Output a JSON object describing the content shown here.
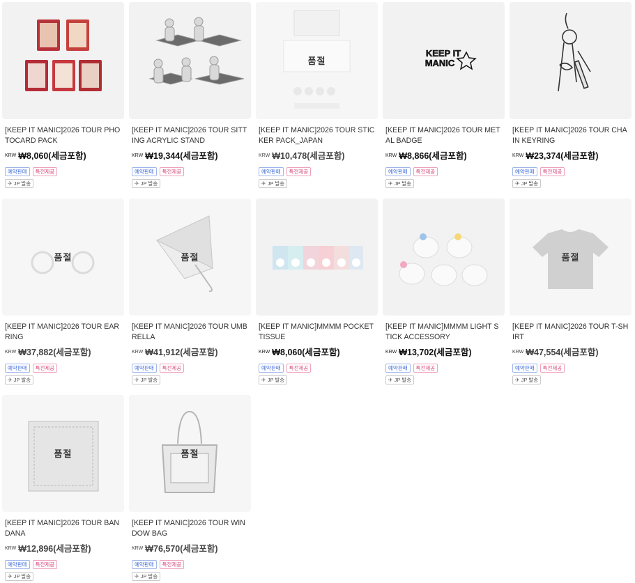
{
  "currency": "KRW",
  "badges": {
    "preorder": "예약판매",
    "bonus": "특전제공",
    "shipping": "JP 발송"
  },
  "soldout_label": "품절",
  "products": [
    {
      "title": "[KEEP IT MANIC]2026 TOUR PHOTOCARD PACK",
      "price": "₩8,060(세금포함)",
      "soldout": false,
      "image": "photocard-pack"
    },
    {
      "title": "[KEEP IT MANIC]2026 TOUR SITTING ACRYLIC STAND",
      "price": "₩19,344(세금포함)",
      "soldout": false,
      "image": "acrylic-stand"
    },
    {
      "title": "[KEEP IT MANIC]2026 TOUR STICKER PACK_JAPAN",
      "price": "₩10,478(세금포함)",
      "soldout": true,
      "image": "sticker-pack"
    },
    {
      "title": "[KEEP IT MANIC]2026 TOUR METAL BADGE",
      "price": "₩8,866(세금포함)",
      "soldout": false,
      "image": "metal-badge",
      "image_text": "KEEP IT MANIC"
    },
    {
      "title": "[KEEP IT MANIC]2026 TOUR CHAIN KEYRING",
      "price": "₩23,374(세금포함)",
      "soldout": false,
      "image": "chain-keyring"
    },
    {
      "title": "[KEEP IT MANIC]2026 TOUR EARRING",
      "price": "₩37,882(세금포함)",
      "soldout": true,
      "image": "earring"
    },
    {
      "title": "[KEEP IT MANIC]2026 TOUR UMBRELLA",
      "price": "₩41,912(세금포함)",
      "soldout": true,
      "image": "umbrella"
    },
    {
      "title": "[KEEP IT MANIC]MMMM POCKET TISSUE",
      "price": "₩8,060(세금포함)",
      "soldout": false,
      "image": "pocket-tissue"
    },
    {
      "title": "[KEEP IT MANIC]MMMM LIGHT STICK ACCESSORY",
      "price": "₩13,702(세금포함)",
      "soldout": false,
      "image": "light-stick-accessory"
    },
    {
      "title": "[KEEP IT MANIC]2026 TOUR T-SHIRT",
      "price": "₩47,554(세금포함)",
      "soldout": true,
      "image": "t-shirt"
    },
    {
      "title": "[KEEP IT MANIC]2026 TOUR BANDANA",
      "price": "₩12,896(세금포함)",
      "soldout": true,
      "image": "bandana"
    },
    {
      "title": "[KEEP IT MANIC]2026 TOUR WINDOW BAG",
      "price": "₩76,570(세금포함)",
      "soldout": true,
      "image": "window-bag"
    }
  ]
}
